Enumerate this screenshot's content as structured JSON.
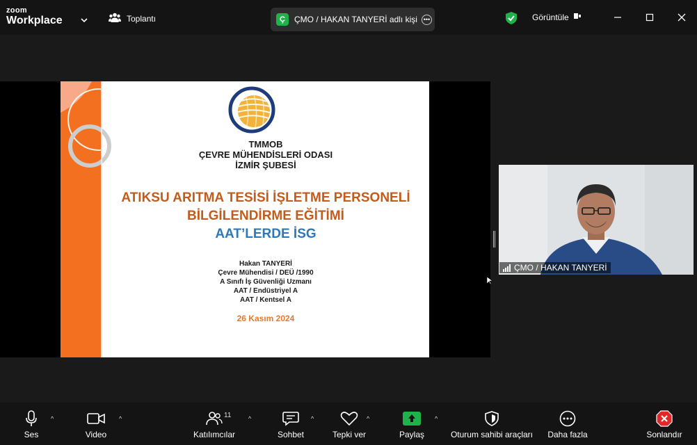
{
  "titlebar": {
    "brand_small": "zoom",
    "brand_large": "Workplace",
    "meeting_label": "Toplantı",
    "speaker_initial": "Ç",
    "speaker_label": "ÇMO / HAKAN TANYERİ adlı kişi",
    "view_label": "Görüntüle",
    "icons": [
      "chevron-down-icon",
      "people-icon",
      "more-icon",
      "shield-check-icon",
      "view-layout-icon",
      "minimize-icon",
      "maximize-icon",
      "close-icon"
    ]
  },
  "slide": {
    "org_line1": "TMMOB",
    "org_line2": "ÇEVRE MÜHENDİSLERİ ODASI",
    "org_line3": "İZMİR ŞUBESİ",
    "title_line1": "ATIKSU ARITMA TESİSİ İŞLETME PERSONELİ",
    "title_line2": "BİLGİLENDİRME EĞİTİMİ",
    "subtitle": "AAT’LERDE İSG",
    "presenter": [
      "Hakan TANYERİ",
      "Çevre  Mühendisi / DEÜ /1990",
      "A Sınıfı İş Güvenliği Uzmanı",
      "AAT / Endüstriyel A",
      "AAT / Kentsel A"
    ],
    "date": "26 Kasım 2024",
    "colors": {
      "band": "#f37021",
      "title": "#c25b1b",
      "subtitle": "#2f78b7",
      "date": "#e47a2e"
    }
  },
  "video": {
    "name_label": "ÇMO / HAKAN TANYERİ"
  },
  "toolbar": {
    "audio_label": "Ses",
    "video_label": "Video",
    "participants_label": "Katılımcılar",
    "participants_count": "11",
    "chat_label": "Sohbet",
    "reactions_label": "Tepki ver",
    "share_label": "Paylaş",
    "host_tools_label": "Oturum sahibi araçları",
    "more_label": "Daha fazla",
    "end_label": "Sonlandır",
    "caret": "^",
    "share_color": "#1fb24a",
    "end_color": "#e02828"
  }
}
